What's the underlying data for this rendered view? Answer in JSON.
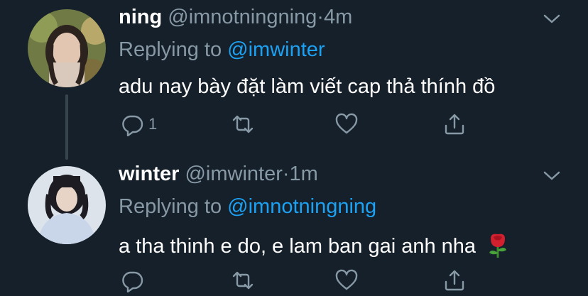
{
  "tweets": [
    {
      "name": "ning",
      "handle": "@imnotningning",
      "separator": "·",
      "time": "4m",
      "replying_label": "Replying to",
      "replying_to": "@imwinter",
      "text": "adu nay bày đặt làm viết cap thả thính đồ",
      "reply_count": "1",
      "retweet_count": "",
      "like_count": ""
    },
    {
      "name": "winter",
      "handle": "@imwinter",
      "separator": "·",
      "time": "1m",
      "replying_label": "Replying to",
      "replying_to": "@imnotningning",
      "text": "a tha thinh e do, e lam ban gai anh nha",
      "emoji": "rose-emoji",
      "reply_count": "",
      "retweet_count": "",
      "like_count": ""
    }
  ],
  "colors": {
    "background": "#15202b",
    "secondary_text": "#8899a6",
    "link": "#1da1f2",
    "thread_line": "#38444d"
  },
  "icons": [
    "reply-icon",
    "retweet-icon",
    "like-icon",
    "share-icon",
    "chevron-down-icon"
  ]
}
